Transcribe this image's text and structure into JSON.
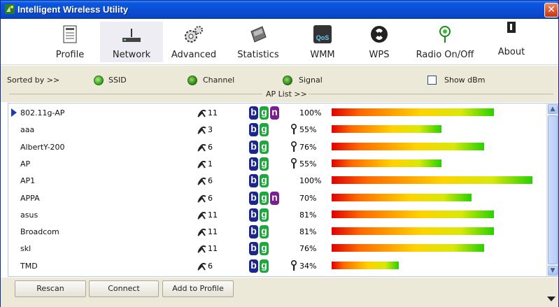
{
  "window": {
    "title": "Intelligent Wireless Utility",
    "close_glyph": "✕"
  },
  "toolbar": {
    "items": [
      {
        "label": "Profile",
        "icon": "profile-icon"
      },
      {
        "label": "Network",
        "icon": "network-icon",
        "active": true
      },
      {
        "label": "Advanced",
        "icon": "advanced-gear-icon"
      },
      {
        "label": "Statistics",
        "icon": "statistics-icon"
      },
      {
        "label": "WMM",
        "icon": "wmm-qos-icon"
      },
      {
        "label": "WPS",
        "icon": "wps-icon"
      },
      {
        "label": "Radio On/Off",
        "icon": "radio-icon"
      },
      {
        "label": "About",
        "icon": "about-icon"
      }
    ],
    "wmm_icon_text": "QoS"
  },
  "sortbar": {
    "sorted_by": "Sorted by >>",
    "ssid": "SSID",
    "channel": "Channel",
    "signal": "Signal",
    "show_dbm": "Show dBm",
    "show_dbm_checked": false,
    "ap_list": "AP List >>"
  },
  "ap_list": [
    {
      "ssid": "802.11g-AP",
      "channel": "11",
      "n": true,
      "lock": false,
      "signal": "100%",
      "level": 0.8,
      "selected": true
    },
    {
      "ssid": "aaa",
      "channel": "3",
      "n": false,
      "lock": true,
      "signal": "55%",
      "level": 0.54
    },
    {
      "ssid": "AlbertY-200",
      "channel": "6",
      "n": false,
      "lock": true,
      "signal": "76%",
      "level": 0.75
    },
    {
      "ssid": "AP",
      "channel": "1",
      "n": false,
      "lock": true,
      "signal": "55%",
      "level": 0.54
    },
    {
      "ssid": "AP1",
      "channel": "6",
      "n": false,
      "lock": false,
      "signal": "100%",
      "level": 0.99
    },
    {
      "ssid": "APPA",
      "channel": "6",
      "n": true,
      "lock": false,
      "signal": "70%",
      "level": 0.69
    },
    {
      "ssid": "asus",
      "channel": "11",
      "n": false,
      "lock": false,
      "signal": "81%",
      "level": 0.8
    },
    {
      "ssid": "Broadcom",
      "channel": "11",
      "n": false,
      "lock": false,
      "signal": "81%",
      "level": 0.8
    },
    {
      "ssid": "skl",
      "channel": "11",
      "n": false,
      "lock": false,
      "signal": "76%",
      "level": 0.75
    },
    {
      "ssid": "TMD",
      "channel": "6",
      "n": false,
      "lock": true,
      "signal": "34%",
      "level": 0.33
    }
  ],
  "badges": {
    "b": "b",
    "g": "g",
    "n": "n"
  },
  "buttons": {
    "rescan": "Rescan",
    "connect": "Connect",
    "add_to_profile": "Add to Profile"
  },
  "colors": {
    "title_bar": "#0a4fd6",
    "panel": "#ece9d8",
    "badge_b": "#1d2690",
    "badge_g": "#1fa63d",
    "badge_n": "#7a1f8e"
  }
}
